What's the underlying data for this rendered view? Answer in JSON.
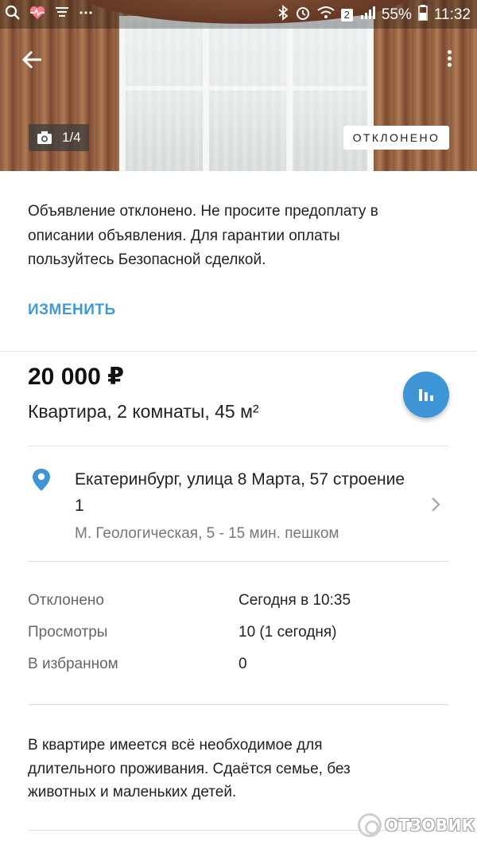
{
  "status_bar": {
    "battery_percent": "55%",
    "time": "11:32",
    "notification_count": "2"
  },
  "hero": {
    "photo_counter": "1/4",
    "status_badge": "ОТКЛОНЕНО"
  },
  "notice": {
    "text": "Объявление отклонено. Не просите предоплату в описании объявления. Для гарантии оплаты пользуйтесь Безопасной сделкой.",
    "edit_label": "ИЗМЕНИТЬ"
  },
  "listing": {
    "price": "20 000 ₽",
    "title": "Квартира, 2 комнаты, 45 м²"
  },
  "address": {
    "line": "Екатеринбург, улица 8 Марта, 57 строение 1",
    "metro": "М. Геологическая, 5 - 15 мин. пешком"
  },
  "meta": [
    {
      "key": "Отклонено",
      "value": "Сегодня в 10:35"
    },
    {
      "key": "Просмотры",
      "value": "10 (1 сегодня)"
    },
    {
      "key": "В избранном",
      "value": "0"
    }
  ],
  "description": "В квартире имеется всё необходимое для длительного проживания. Сдаётся семье, без животных и маленьких детей.",
  "watermark": "ОТЗОВИК",
  "colors": {
    "accent": "#3f9bd6",
    "fab": "#3d95d6"
  }
}
